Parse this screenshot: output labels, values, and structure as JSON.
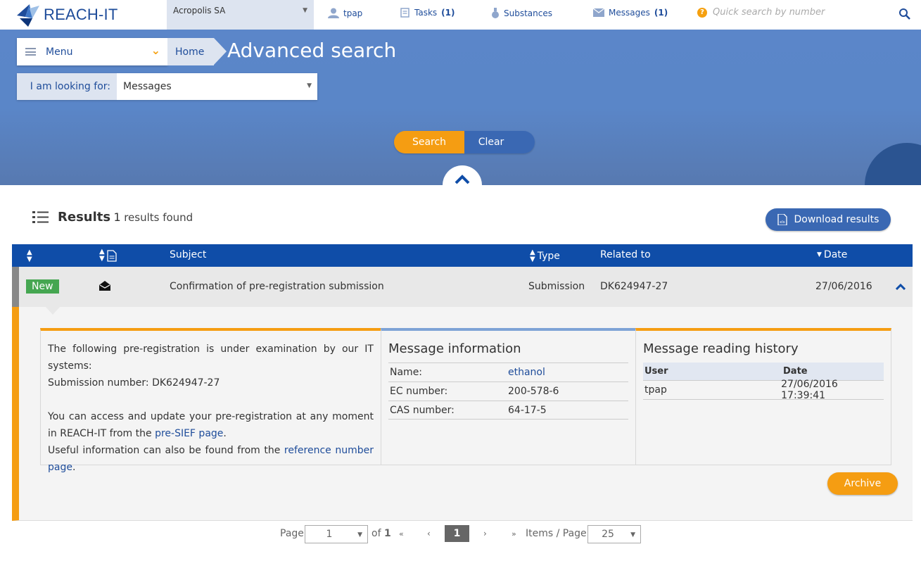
{
  "app": {
    "logo_text": "REACH-IT",
    "company": "Acropolis SA",
    "user": "tpap",
    "tasks_label": "Tasks",
    "tasks_count": "(1)",
    "substances_label": "Substances",
    "messages_label": "Messages",
    "messages_count": "(1)",
    "quick_search_placeholder": "Quick search by number"
  },
  "banner": {
    "menu_label": "Menu",
    "breadcrumb_home": "Home",
    "page_title": "Advanced search",
    "looking_for_label": "I am looking for:",
    "looking_for_value": "Messages",
    "search_label": "Search",
    "clear_label": "Clear"
  },
  "results": {
    "label": "Results",
    "count": "1",
    "found_text": "results found",
    "download_label": "Download results"
  },
  "table": {
    "headers": {
      "subject": "Subject",
      "type": "Type",
      "related": "Related to",
      "date": "Date"
    },
    "row": {
      "badge": "New",
      "subject": "Confirmation of pre-registration submission",
      "type": "Submission",
      "related": "DK624947-27",
      "date": "27/06/2016"
    }
  },
  "detail": {
    "line1": "The following pre-registration is under examination by our IT systems:",
    "line2": "Submission number: DK624947-27",
    "line3a": "You can access and update your pre-registration at any moment in REACH-IT from the ",
    "link1": "pre-SIEF page",
    "line3b": ".",
    "line4a": "Useful information can also be found from the ",
    "link2": "reference number page",
    "line4b": ".",
    "info_title": "Message information",
    "info": [
      {
        "k": "Name:",
        "v": "ethanol"
      },
      {
        "k": "EC number:",
        "v": "200-578-6"
      },
      {
        "k": "CAS number:",
        "v": "64-17-5"
      }
    ],
    "history_title": "Message reading history",
    "history_headers": {
      "user": "User",
      "date": "Date"
    },
    "history_row": {
      "user": "tpap",
      "date": "27/06/2016 17:39:41"
    },
    "archive_label": "Archive"
  },
  "pager": {
    "page_label": "Page",
    "page_value": "1",
    "of_label": "of",
    "of_total": "1",
    "first": "«",
    "prev": "‹",
    "current": "1",
    "next": "›",
    "last": "»",
    "items_label": "Items / Page:",
    "items_value": "25"
  },
  "colors": {
    "accent": "#f59d12",
    "brand_blue": "#0f4da8",
    "new_badge": "#45a651"
  }
}
